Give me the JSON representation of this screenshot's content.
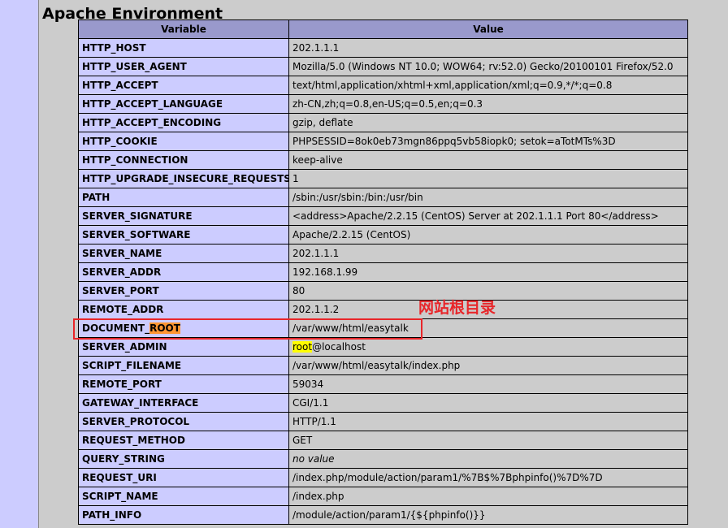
{
  "section": {
    "title": "Apache Environment"
  },
  "table": {
    "headers": [
      "Variable",
      "Value"
    ],
    "rows": [
      [
        "HTTP_HOST",
        "202.1.1.1"
      ],
      [
        "HTTP_USER_AGENT",
        "Mozilla/5.0 (Windows NT 10.0; WOW64; rv:52.0) Gecko/20100101 Firefox/52.0"
      ],
      [
        "HTTP_ACCEPT",
        "text/html,application/xhtml+xml,application/xml;q=0.9,*/*;q=0.8"
      ],
      [
        "HTTP_ACCEPT_LANGUAGE",
        "zh-CN,zh;q=0.8,en-US;q=0.5,en;q=0.3"
      ],
      [
        "HTTP_ACCEPT_ENCODING",
        "gzip, deflate"
      ],
      [
        "HTTP_COOKIE",
        "PHPSESSID=8ok0eb73mgn86ppq5vb58iopk0; setok=aTotMTs%3D"
      ],
      [
        "HTTP_CONNECTION",
        "keep-alive"
      ],
      [
        "HTTP_UPGRADE_INSECURE_REQUESTS",
        "1"
      ],
      [
        "PATH",
        "/sbin:/usr/sbin:/bin:/usr/bin"
      ],
      [
        "SERVER_SIGNATURE",
        "<address>Apache/2.2.15 (CentOS) Server at 202.1.1.1 Port 80</address>"
      ],
      [
        "SERVER_SOFTWARE",
        "Apache/2.2.15 (CentOS)"
      ],
      [
        "SERVER_NAME",
        "202.1.1.1"
      ],
      [
        "SERVER_ADDR",
        "192.168.1.99"
      ],
      [
        "SERVER_PORT",
        "80"
      ],
      [
        "REMOTE_ADDR",
        "202.1.1.2"
      ],
      [
        "DOCUMENT_ROOT",
        "/var/www/html/easytalk"
      ],
      [
        "SERVER_ADMIN",
        "root@localhost"
      ],
      [
        "SCRIPT_FILENAME",
        "/var/www/html/easytalk/index.php"
      ],
      [
        "REMOTE_PORT",
        "59034"
      ],
      [
        "GATEWAY_INTERFACE",
        "CGI/1.1"
      ],
      [
        "SERVER_PROTOCOL",
        "HTTP/1.1"
      ],
      [
        "REQUEST_METHOD",
        "GET"
      ],
      [
        "QUERY_STRING",
        "no value"
      ],
      [
        "REQUEST_URI",
        "/index.php/module/action/param1/%7B$%7Bphpinfo()%7D%7D"
      ],
      [
        "SCRIPT_NAME",
        "/index.php"
      ],
      [
        "PATH_INFO",
        "/module/action/param1/{${phpinfo()}}"
      ]
    ]
  },
  "highlights": {
    "search_term": "ROOT",
    "document_root_match": "ROOT",
    "server_admin_match": "root",
    "active_color": "#ff9632",
    "match_color": "#ffff00"
  },
  "annotation": {
    "label": "网站根目录",
    "color": "#e8262a"
  },
  "colors": {
    "page_bg": "#ccccff",
    "header_bg": "#9999cc",
    "var_col_bg": "#ccccff",
    "val_col_bg": "#cccccc"
  }
}
